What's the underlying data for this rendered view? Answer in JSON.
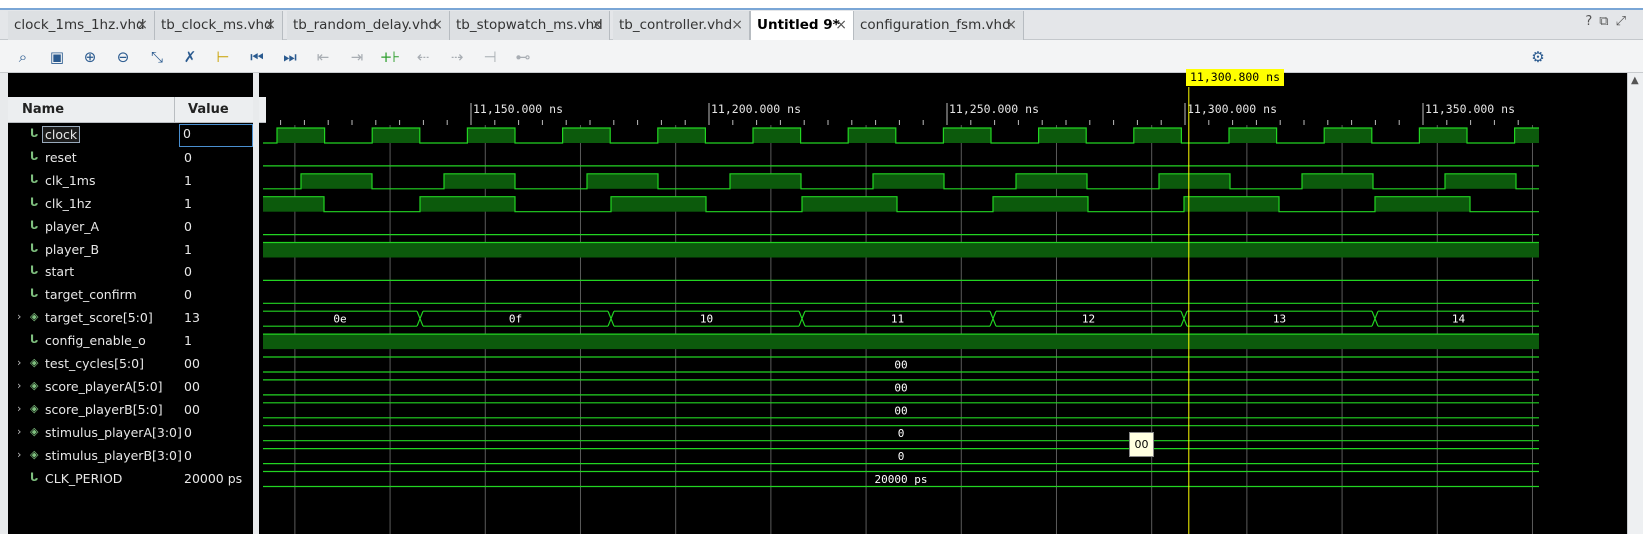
{
  "tabs": [
    {
      "label": "clock_1ms_1hz.vhd",
      "active": false
    },
    {
      "label": "tb_clock_ms.vhd",
      "active": false
    },
    {
      "label": "tb_random_delay.vhd",
      "active": false
    },
    {
      "label": "tb_stopwatch_ms.vhd",
      "active": false
    },
    {
      "label": "tb_controller.vhd",
      "active": false
    },
    {
      "label": "Untitled 9*",
      "active": true
    },
    {
      "label": "configuration_fsm.vhd",
      "active": false
    }
  ],
  "window_buttons": {
    "help": "?",
    "restore": "⧉",
    "maximize": "⤢"
  },
  "toolbar_icons": [
    "search-icon",
    "save-icon",
    "zoom-in-icon",
    "zoom-out-icon",
    "zoom-fit-icon",
    "swap-cursor-icon",
    "go-to-cursor-icon",
    "go-to-start-icon",
    "go-to-end-icon",
    "previous-transition-icon",
    "next-transition-icon",
    "add-marker-icon",
    "previous-marker-icon",
    "next-marker-icon",
    "snap-marker-icon",
    "expand-marker-icon",
    "settings-icon"
  ],
  "columns": {
    "name": "Name",
    "value": "Value"
  },
  "cursor": {
    "label": "11,300.800 ns",
    "time_ns": 11300.8
  },
  "timeline": {
    "labels": [
      "11,150.000 ns",
      "11,200.000 ns",
      "11,250.000 ns",
      "11,300.000 ns",
      "11,350.000 ns"
    ],
    "label_times_ns": [
      11150,
      11200,
      11250,
      11300,
      11350
    ]
  },
  "signals": [
    {
      "name": "clock",
      "value": "0",
      "kind": "bit",
      "expandable": false,
      "selected": true
    },
    {
      "name": "reset",
      "value": "0",
      "kind": "bit",
      "expandable": false
    },
    {
      "name": "clk_1ms",
      "value": "1",
      "kind": "bit",
      "expandable": false
    },
    {
      "name": "clk_1hz",
      "value": "1",
      "kind": "bit",
      "expandable": false
    },
    {
      "name": "player_A",
      "value": "0",
      "kind": "bit",
      "expandable": false
    },
    {
      "name": "player_B",
      "value": "1",
      "kind": "bit",
      "expandable": false
    },
    {
      "name": "start",
      "value": "0",
      "kind": "bit",
      "expandable": false
    },
    {
      "name": "target_confirm",
      "value": "0",
      "kind": "bit",
      "expandable": false
    },
    {
      "name": "target_score[5:0]",
      "value": "13",
      "kind": "bus",
      "expandable": true,
      "bus_values": [
        "0e",
        "0f",
        "10",
        "11",
        "12",
        "13",
        "14"
      ]
    },
    {
      "name": "config_enable_o",
      "value": "1",
      "kind": "bit",
      "expandable": false
    },
    {
      "name": "test_cycles[5:0]",
      "value": "00",
      "kind": "bus",
      "expandable": true,
      "bus_values": [
        "00"
      ]
    },
    {
      "name": "score_playerA[5:0]",
      "value": "00",
      "kind": "bus",
      "expandable": true,
      "bus_values": [
        "00"
      ]
    },
    {
      "name": "score_playerB[5:0]",
      "value": "00",
      "kind": "bus",
      "expandable": true,
      "bus_values": [
        "00"
      ]
    },
    {
      "name": "stimulus_playerA[3:0]",
      "value": "0",
      "kind": "bus",
      "expandable": true,
      "bus_values": [
        "0"
      ]
    },
    {
      "name": "stimulus_playerB[3:0]",
      "value": "0",
      "kind": "bus",
      "expandable": true,
      "bus_values": [
        "0"
      ]
    },
    {
      "name": "CLK_PERIOD",
      "value": "20000 ps",
      "kind": "const",
      "expandable": false,
      "bus_values": [
        "20000 ps"
      ]
    }
  ],
  "tooltip": "00",
  "colors": {
    "wave": "#22d422",
    "fill": "#0c5a0c",
    "grid": "#5a5a5a",
    "cursor": "#ffff00",
    "background": "#000000"
  }
}
